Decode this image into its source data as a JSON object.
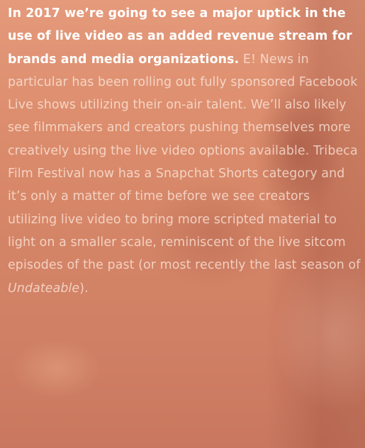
{
  "article": {
    "lead": "In 2017 we’re going to see a major uptick in the use of live video as an added revenue stream for brands and media organizations.",
    "body_before": " E! News in particular has been rolling out fully sponsored Facebook Live shows utilizing their on-air talent. We’ll also likely see filmmakers and creators pushing themselves more creatively using the live video options available. Tribeca Film Festival now has a Snapchat Shorts category and it’s only a matter of time before we see creators utilizing live video to bring more scripted material to light on a smaller scale, reminiscent of the live sitcom episodes of the past (or most recently the last season of ",
    "show_title": "Undateable",
    "body_after": ")."
  },
  "colors": {
    "background": "#d88a6a",
    "lead_text": "#ffffff",
    "body_text": "#ffeee4"
  }
}
